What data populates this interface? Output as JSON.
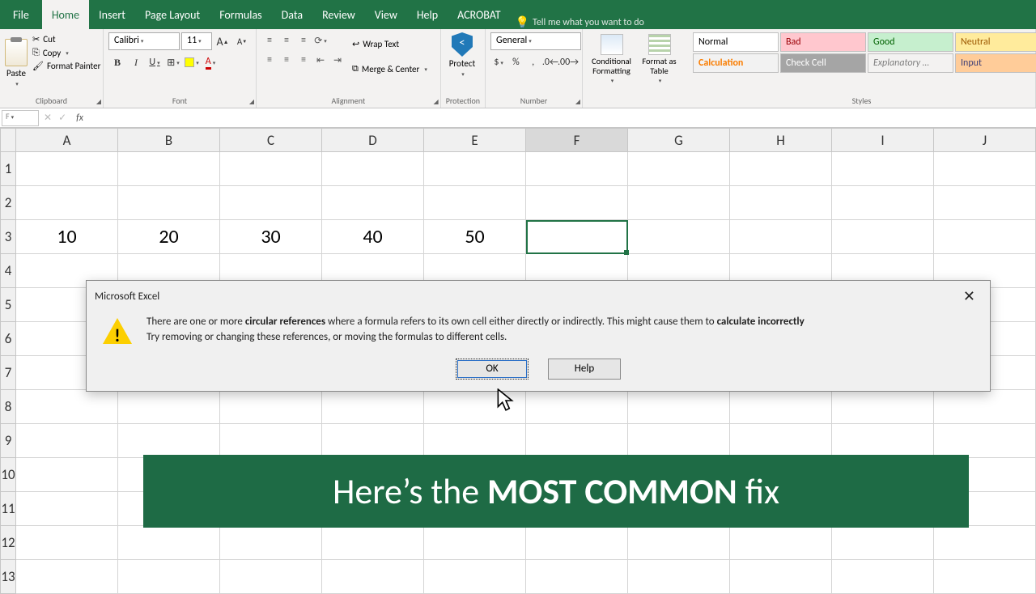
{
  "tabs": {
    "file": "File",
    "home": "Home",
    "insert": "Insert",
    "pagelayout": "Page Layout",
    "formulas": "Formulas",
    "data": "Data",
    "review": "Review",
    "view": "View",
    "help": "Help",
    "acrobat": "ACROBAT",
    "tellme": "Tell me what you want to do"
  },
  "ribbon": {
    "clipboard": {
      "paste": "Paste",
      "cut": "Cut",
      "copy": "Copy",
      "format_painter": "Format Painter",
      "label": "Clipboard"
    },
    "font": {
      "name": "Calibri",
      "size": "11",
      "increase": "A",
      "decrease": "A",
      "bold": "B",
      "italic": "I",
      "underline": "U",
      "label": "Font"
    },
    "alignment": {
      "wrap": "Wrap Text",
      "merge": "Merge & Center",
      "label": "Alignment"
    },
    "protection": {
      "protect": "Protect",
      "label": "Protection"
    },
    "number": {
      "format": "General",
      "label": "Number"
    },
    "cf": {
      "cond": "Conditional Formatting",
      "table": "Format as Table"
    },
    "styles": {
      "normal": "Normal",
      "bad": "Bad",
      "good": "Good",
      "neutral": "Neutral",
      "calc": "Calculation",
      "check": "Check Cell",
      "explan": "Explanatory …",
      "input": "Input",
      "label": "Styles"
    }
  },
  "formula_bar": {
    "namebox": "F",
    "value": ""
  },
  "columns": [
    "A",
    "B",
    "C",
    "D",
    "E",
    "F",
    "G",
    "H",
    "I",
    "J"
  ],
  "rows": [
    "1",
    "2",
    "3",
    "4",
    "5",
    "6",
    "7",
    "8",
    "9",
    "10",
    "11",
    "12",
    "13"
  ],
  "selected_col_index": 5,
  "data_row3": [
    "10",
    "20",
    "30",
    "40",
    "50",
    "",
    "",
    "",
    "",
    ""
  ],
  "dialog": {
    "title": "Microsoft Excel",
    "msg_p1": "There are one or more ",
    "msg_b1": "circular references",
    "msg_p2": " where a formula refers to its own cell either directly or indirectly. This might cause them to ",
    "msg_b2": "calculate incorrectly",
    "msg_line2": "Try removing or changing these references, or moving the formulas to different cells.",
    "ok": "OK",
    "help": "Help"
  },
  "banner": {
    "t1": "Here’s the ",
    "t2": "MOST COMMON",
    "t3": " fix"
  }
}
